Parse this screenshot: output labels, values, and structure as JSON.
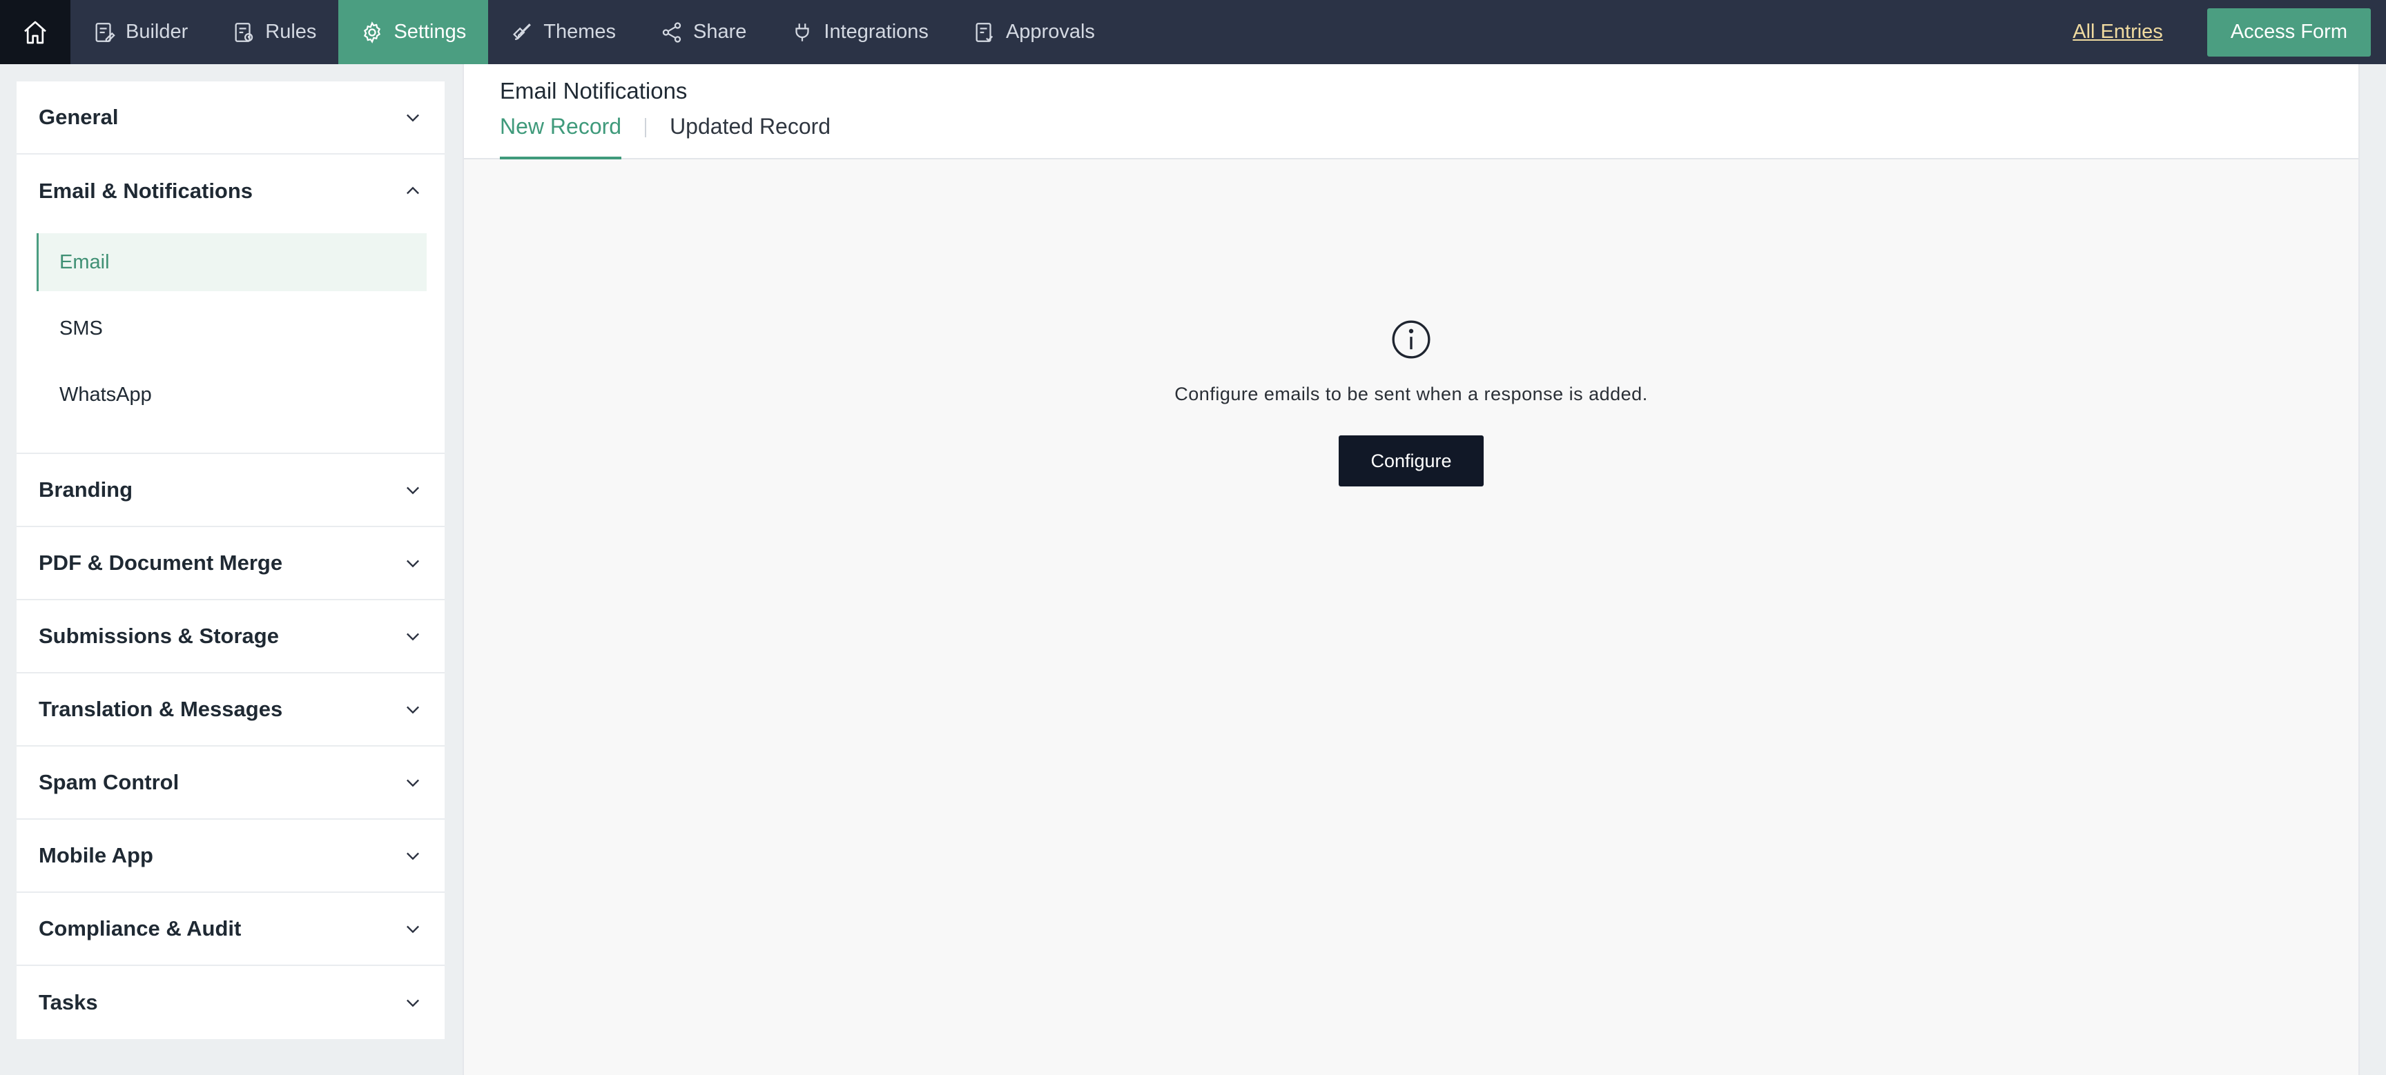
{
  "topbar": {
    "home_icon": "home-icon",
    "nav": [
      {
        "label": "Builder",
        "icon": "builder-icon"
      },
      {
        "label": "Rules",
        "icon": "rules-icon"
      },
      {
        "label": "Settings",
        "icon": "gear-icon",
        "active": true
      },
      {
        "label": "Themes",
        "icon": "brush-icon"
      },
      {
        "label": "Share",
        "icon": "share-icon"
      },
      {
        "label": "Integrations",
        "icon": "plug-icon"
      },
      {
        "label": "Approvals",
        "icon": "approvals-icon"
      }
    ],
    "all_entries": "All Entries",
    "access_form": "Access Form"
  },
  "sidebar": {
    "sections": [
      {
        "label": "General",
        "expanded": false
      },
      {
        "label": "Email & Notifications",
        "expanded": true,
        "items": [
          {
            "label": "Email",
            "active": true
          },
          {
            "label": "SMS"
          },
          {
            "label": "WhatsApp"
          }
        ]
      },
      {
        "label": "Branding",
        "expanded": false
      },
      {
        "label": "PDF & Document Merge",
        "expanded": false
      },
      {
        "label": "Submissions & Storage",
        "expanded": false
      },
      {
        "label": "Translation & Messages",
        "expanded": false
      },
      {
        "label": "Spam Control",
        "expanded": false
      },
      {
        "label": "Mobile App",
        "expanded": false
      },
      {
        "label": "Compliance & Audit",
        "expanded": false
      },
      {
        "label": "Tasks",
        "expanded": false
      }
    ]
  },
  "main": {
    "title": "Email Notifications",
    "tabs": [
      {
        "label": "New Record",
        "active": true
      },
      {
        "label": "Updated Record"
      }
    ],
    "empty_state": {
      "icon": "info-icon",
      "message": "Configure emails to be sent when a response is added.",
      "button": "Configure"
    }
  },
  "colors": {
    "topbar_bg": "#2b3346",
    "accent": "#4b9e81",
    "home_bg": "#0f141c",
    "all_entries": "#f0dba0",
    "configure_btn": "#111827"
  }
}
